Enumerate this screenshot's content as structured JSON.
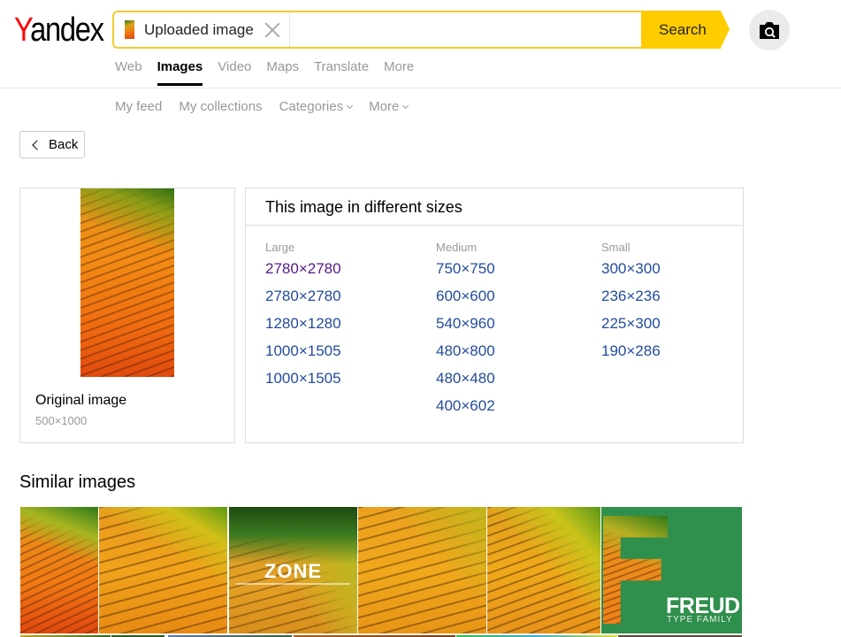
{
  "header": {
    "logo_first_letter": "Y",
    "logo_rest": "andex",
    "search": {
      "chip_label": "Uploaded image",
      "input_value": "",
      "button_label": "Search"
    },
    "camera_button_icon": "camera-search-icon"
  },
  "service_nav": [
    {
      "label": "Web",
      "active": false
    },
    {
      "label": "Images",
      "active": true
    },
    {
      "label": "Video",
      "active": false
    },
    {
      "label": "Maps",
      "active": false
    },
    {
      "label": "Translate",
      "active": false
    },
    {
      "label": "More",
      "active": false
    }
  ],
  "sub_nav": [
    {
      "label": "My feed",
      "dropdown": false
    },
    {
      "label": "My collections",
      "dropdown": false
    },
    {
      "label": "Categories",
      "dropdown": true
    },
    {
      "label": "More",
      "dropdown": true
    }
  ],
  "back_button": {
    "label": "Back"
  },
  "original_image": {
    "title": "Original image",
    "dimensions": "500×1000"
  },
  "sizes": {
    "title": "This image in different sizes",
    "columns": [
      {
        "label": "Large",
        "items": [
          "2780×2780",
          "2780×2780",
          "1280×1280",
          "1000×1505",
          "1000×1505"
        ],
        "visited": [
          true,
          false,
          false,
          false,
          false
        ]
      },
      {
        "label": "Medium",
        "items": [
          "750×750",
          "600×600",
          "540×960",
          "480×800",
          "480×480",
          "400×602"
        ],
        "visited": [
          false,
          false,
          false,
          false,
          false,
          false
        ]
      },
      {
        "label": "Small",
        "items": [
          "300×300",
          "236×236",
          "225×300",
          "190×286"
        ],
        "visited": [
          false,
          false,
          false,
          false
        ]
      }
    ]
  },
  "similar": {
    "title": "Similar images",
    "tiles": [
      {
        "overlay": ""
      },
      {
        "overlay": ""
      },
      {
        "overlay": "ZONE"
      },
      {
        "overlay": ""
      },
      {
        "overlay": ""
      },
      {
        "overlay": "FREUD",
        "subtitle": "TYPE FAMILY"
      }
    ]
  },
  "colors": {
    "accent_yellow": "#ffcc00",
    "search_border": "#f2cb2f",
    "link_blue": "#224b9d",
    "link_visited": "#551a8b",
    "logo_red": "#ff0000"
  }
}
